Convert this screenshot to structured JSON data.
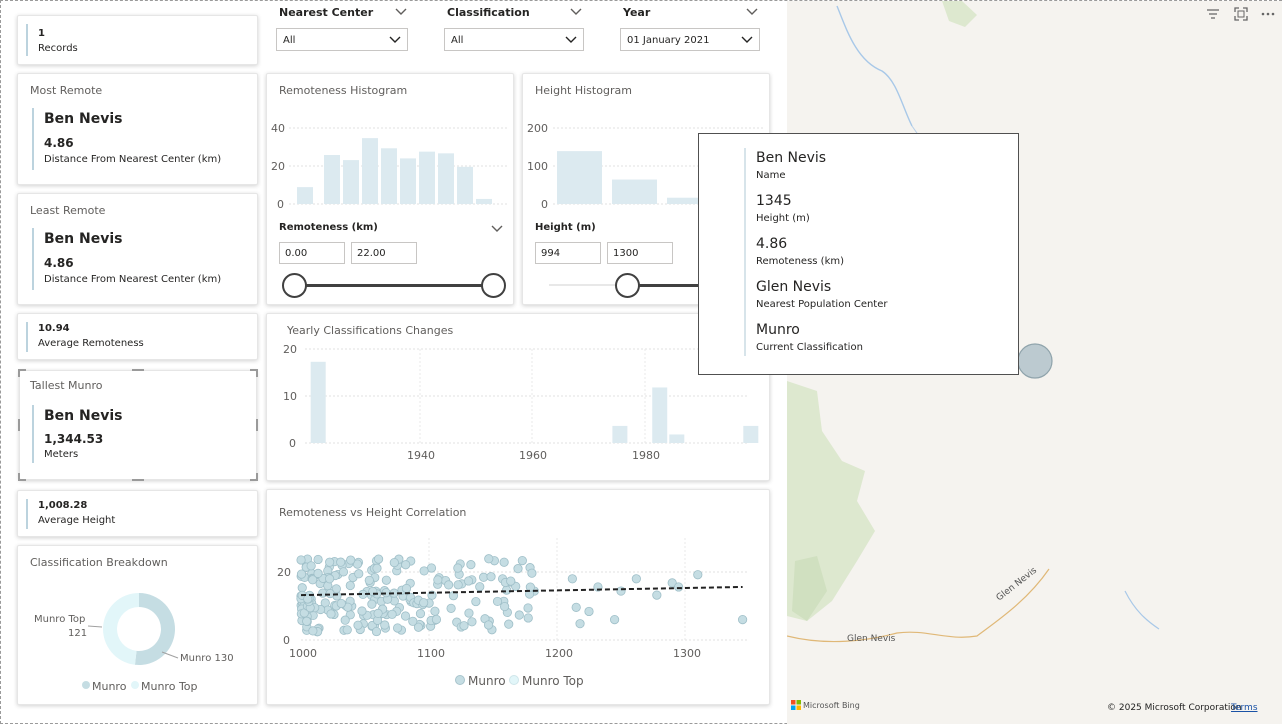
{
  "records": {
    "value": "1",
    "label": "Records"
  },
  "filters": [
    {
      "title": "Nearest Center",
      "value": "All"
    },
    {
      "title": "Classification",
      "value": "All"
    },
    {
      "title": "Year",
      "value": "01 January 2021"
    }
  ],
  "most_remote": {
    "title": "Most Remote",
    "name": "Ben Nevis",
    "value": "4.86",
    "label": "Distance From Nearest Center (km)"
  },
  "least_remote": {
    "title": "Least Remote",
    "name": "Ben Nevis",
    "value": "4.86",
    "label": "Distance From Nearest Center (km)"
  },
  "avg_remoteness": {
    "value": "10.94",
    "label": "Average Remoteness"
  },
  "tallest": {
    "title": "Tallest Munro",
    "name": "Ben Nevis",
    "value": "1,344.53",
    "label": "Meters"
  },
  "avg_height": {
    "value": "1,008.28",
    "label": "Average Height"
  },
  "classification_breakdown": {
    "title": "Classification Breakdown",
    "label_top": "Munro Top",
    "label_top_value": "121",
    "label_munro": "Munro 130",
    "legend": [
      "Munro",
      "Munro Top"
    ]
  },
  "remoteness_hist": {
    "title": "Remoteness Histogram",
    "slider_title": "Remoteness (km)",
    "min": "0.00",
    "max": "22.00",
    "y_ticks": [
      "40",
      "20",
      "0"
    ]
  },
  "height_hist": {
    "title": "Height Histogram",
    "slider_title": "Height (m)",
    "min": "994",
    "max": "1300",
    "y_ticks": [
      "200",
      "100",
      "0"
    ]
  },
  "yearly": {
    "title": "Yearly Classifications Changes",
    "y_ticks": [
      "20",
      "10",
      "0"
    ],
    "x_ticks": [
      "1940",
      "1960",
      "1980"
    ]
  },
  "scatter": {
    "title": "Remoteness vs Height Correlation",
    "y_ticks": [
      "20",
      "0"
    ],
    "x_ticks": [
      "1000",
      "1100",
      "1200",
      "1300"
    ],
    "legend": [
      "Munro",
      "Munro Top"
    ]
  },
  "tooltip": {
    "name": "Ben Nevis",
    "name_label": "Name",
    "height": "1345",
    "height_label": "Height (m)",
    "remoteness": "4.86",
    "remoteness_label": "Remoteness (km)",
    "center": "Glen Nevis",
    "center_label": "Nearest Population Center",
    "classification": "Munro",
    "classification_label": "Current Classification"
  },
  "map": {
    "road_label_1": "Glen Nevis",
    "road_label_2": "Glen Nevis",
    "bing": "Microsoft Bing",
    "copyright": "© 2025 Microsoft Corporation",
    "terms": "Terms"
  },
  "colors": {
    "accent": "#bcd3de",
    "bar": "#dceaf0",
    "munro": "#c5dde3",
    "munro_top": "#e2f6f9"
  },
  "chart_data": [
    {
      "type": "bar",
      "title": "Remoteness Histogram",
      "values": [
        10,
        29,
        26,
        39,
        33,
        27,
        31,
        30,
        22,
        3
      ],
      "ylim": [
        0,
        45
      ]
    },
    {
      "type": "bar",
      "title": "Height Histogram",
      "values": [
        160,
        74,
        19
      ],
      "ylim": [
        0,
        230
      ]
    },
    {
      "type": "bar",
      "title": "Yearly Classifications Changes",
      "x": [
        1921,
        1974,
        1981,
        1984,
        1997
      ],
      "values": [
        19,
        4,
        13,
        2,
        4
      ],
      "xlim": [
        1920,
        1998
      ],
      "ylim": [
        0,
        22
      ]
    },
    {
      "type": "pie",
      "title": "Classification Breakdown",
      "categories": [
        "Munro",
        "Munro Top"
      ],
      "values": [
        130,
        121
      ]
    },
    {
      "type": "scatter",
      "title": "Remoteness vs Height Correlation",
      "xlim": [
        1000,
        1350
      ],
      "ylim": [
        0,
        25
      ],
      "trend": [
        [
          1000,
          11
        ],
        [
          1345,
          13
        ]
      ]
    }
  ]
}
